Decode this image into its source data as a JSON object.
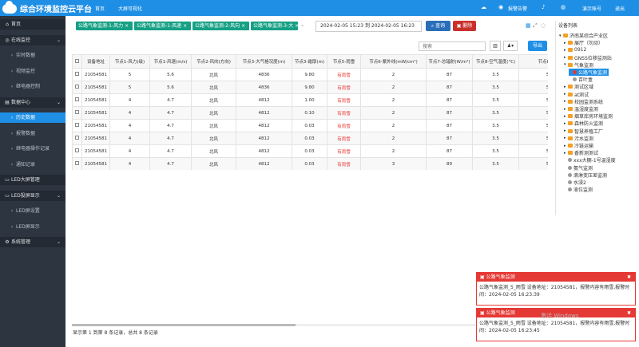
{
  "app": {
    "title": "综合环境监控云平台",
    "nav": [
      "首页",
      "大屏可视化"
    ],
    "right": [
      "报警告警",
      "演示账号",
      "退出"
    ]
  },
  "sidebar": [
    {
      "label": "首页",
      "icon": "home-icon",
      "type": "top"
    },
    {
      "label": "在线监控",
      "icon": "globe-icon",
      "type": "top",
      "arrow": "⌄"
    },
    {
      "label": "实时数据",
      "type": "sub"
    },
    {
      "label": "视频监控",
      "type": "sub"
    },
    {
      "label": "继电器控制",
      "type": "sub"
    },
    {
      "label": "数据中心",
      "icon": "database-icon",
      "type": "top",
      "arrow": "⌄"
    },
    {
      "label": "历史数据",
      "type": "sub",
      "active": true
    },
    {
      "label": "报警数据",
      "type": "sub"
    },
    {
      "label": "继电器操作记录",
      "type": "sub"
    },
    {
      "label": "通知记录",
      "type": "sub"
    },
    {
      "label": "LED大屏管理",
      "icon": "monitor-icon",
      "type": "top"
    },
    {
      "label": "LED投屏显示",
      "icon": "monitor-icon",
      "type": "top",
      "arrow": "⌄"
    },
    {
      "label": "LED屏设置",
      "type": "sub"
    },
    {
      "label": "LED屏显示",
      "type": "sub"
    },
    {
      "label": "系统管理",
      "icon": "gear-icon",
      "type": "top",
      "arrow": "⌄"
    }
  ],
  "filters": {
    "chips": [
      "公路气象监测-1-风力",
      "公路气象监测-1-风速",
      "公路气象监测-2-风向",
      "公路气象监测-3-大"
    ],
    "date_range": "2024-02-05 15:23 到 2024-02-05 16:23",
    "query": "查询",
    "delete": "删除"
  },
  "toolbar": {
    "search_placeholder": "搜索",
    "export": "导出"
  },
  "table": {
    "headers": [
      "设备地址",
      "节点1-风力(级)",
      "节点1-风速(m/s)",
      "节点2-风向(方向)",
      "节点3-大气格况度(m)",
      "节点3-霜厚(m)",
      "节点5-雨雪",
      "节点6-紫外线(mW/cm²)",
      "节点7-总辐射(W/m²)",
      "节点8-空气温度(°C)",
      "节点8-空气湿"
    ],
    "rows": [
      [
        "21054581",
        "5",
        "5.6",
        "北风",
        "4836",
        "9.80",
        "有雨雪",
        "2",
        "87",
        "3.5",
        "57.9"
      ],
      [
        "21054581",
        "5",
        "5.6",
        "北风",
        "4836",
        "9.80",
        "有雨雪",
        "2",
        "87",
        "3.5",
        "57.9"
      ],
      [
        "21054581",
        "4",
        "4.7",
        "北风",
        "4812",
        "1.00",
        "有雨雪",
        "2",
        "87",
        "3.5",
        "57.9"
      ],
      [
        "21054581",
        "4",
        "4.7",
        "北风",
        "4812",
        "0.10",
        "有雨雪",
        "2",
        "87",
        "3.5",
        "57.9"
      ],
      [
        "21054581",
        "4",
        "4.7",
        "北风",
        "4812",
        "0.03",
        "有雨雪",
        "2",
        "87",
        "3.5",
        "57.9"
      ],
      [
        "21054581",
        "4",
        "4.7",
        "北风",
        "4812",
        "0.03",
        "有雨雪",
        "2",
        "87",
        "3.5",
        "57.9"
      ],
      [
        "21054581",
        "4",
        "4.7",
        "北风",
        "4812",
        "0.03",
        "有雨雪",
        "2",
        "87",
        "3.5",
        "57.9"
      ],
      [
        "21054581",
        "4",
        "4.7",
        "北风",
        "4812",
        "0.03",
        "有雨雪",
        "3",
        "89",
        "3.5",
        "57.9"
      ]
    ]
  },
  "pager": "显示第 1 到第 8 条记录，总共 8 条记录",
  "tree": {
    "title": "设备列表",
    "nodes": [
      {
        "label": "济南某综合产业区",
        "kind": "folder",
        "exp": "▾",
        "lvl": 0
      },
      {
        "label": "展厅（勿动）",
        "kind": "folder",
        "exp": "▸",
        "lvl": 1
      },
      {
        "label": "0912",
        "kind": "folder",
        "exp": "▸",
        "lvl": 1
      },
      {
        "label": "GNSS位移监测站",
        "kind": "folder",
        "exp": "▸",
        "lvl": 1
      },
      {
        "label": "气象监测",
        "kind": "folder",
        "exp": "▾",
        "lvl": 1
      },
      {
        "label": "公路气象监测",
        "kind": "dot-red",
        "exp": "",
        "lvl": 2,
        "selected": true
      },
      {
        "label": "百叶盒",
        "kind": "dot",
        "exp": "",
        "lvl": 2
      },
      {
        "label": "测试区域",
        "kind": "folder",
        "exp": "▸",
        "lvl": 1
      },
      {
        "label": "at测试",
        "kind": "folder",
        "exp": "▸",
        "lvl": 1
      },
      {
        "label": "校园监测系统",
        "kind": "folder",
        "exp": "▸",
        "lvl": 1
      },
      {
        "label": "温湿度监测",
        "kind": "folder",
        "exp": "▸",
        "lvl": 1
      },
      {
        "label": "烟草库房环境监测",
        "kind": "folder",
        "exp": "▸",
        "lvl": 1
      },
      {
        "label": "森林防火监测",
        "kind": "folder",
        "exp": "▸",
        "lvl": 1
      },
      {
        "label": "智慧养殖工厂",
        "kind": "folder",
        "exp": "▸",
        "lvl": 1
      },
      {
        "label": "污水监测",
        "kind": "folder",
        "exp": "▸",
        "lvl": 1
      },
      {
        "label": "冷链运输",
        "kind": "folder",
        "exp": "▸",
        "lvl": 1
      },
      {
        "label": "香新测测试",
        "kind": "folder",
        "exp": "▸",
        "lvl": 1
      },
      {
        "label": "xxx大棚-1号温湿度",
        "kind": "dot",
        "exp": "",
        "lvl": 1
      },
      {
        "label": "氨气监测",
        "kind": "dot",
        "exp": "",
        "lvl": 1
      },
      {
        "label": "滴淋变压差监测",
        "kind": "dot",
        "exp": "",
        "lvl": 1
      },
      {
        "label": "水浸2",
        "kind": "dot",
        "exp": "",
        "lvl": 1
      },
      {
        "label": "液位监测",
        "kind": "dot",
        "exp": "",
        "lvl": 1
      }
    ]
  },
  "alerts": [
    {
      "title": "公路气象监测",
      "body": "公路气象监测_5_雨雪 设备地址：21054581，报警内容有雨雪,报警时间：2024-02-05 16:23:39"
    },
    {
      "title": "公路气象监测",
      "body": "公路气象监测_5_雨雪 设备地址：21054581，报警内容有雨雪,报警时间：2024-02-05 16:23:45"
    }
  ],
  "watermark": "激活 Windows",
  "colors": {
    "brand": "#1f8fe5",
    "sidebar": "#2c3540",
    "chip": "#16a085",
    "danger": "#e53935"
  }
}
